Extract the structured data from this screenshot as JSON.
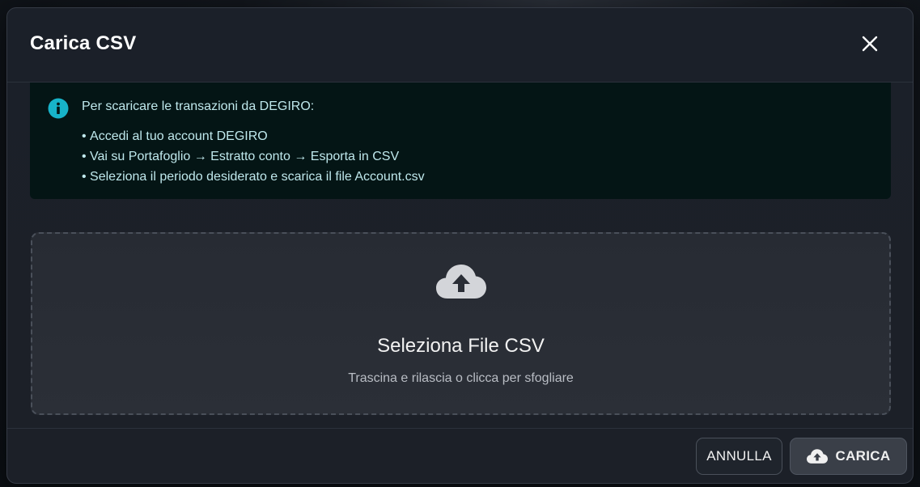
{
  "dialog": {
    "title": "Carica CSV"
  },
  "info": {
    "heading": "Per scaricare le transazioni da DEGIRO:",
    "steps": [
      "Accedi al tuo account DEGIRO",
      "Vai su Portafoglio → Estratto conto → Esporta in CSV",
      "Seleziona il periodo desiderato e scarica il file Account.csv"
    ],
    "icon": "info-icon",
    "color": "#17b3c9"
  },
  "dropzone": {
    "title": "Seleziona File CSV",
    "subtitle": "Trascina e rilascia o clicca per sfogliare",
    "icon": "cloud-upload-icon"
  },
  "footer": {
    "cancel_label": "ANNULLA",
    "upload_label": "CARICA"
  }
}
